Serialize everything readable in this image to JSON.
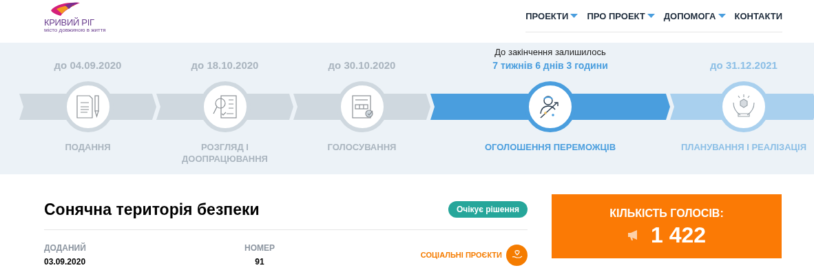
{
  "logo": {
    "name": "КРИВИЙ РІГ",
    "tagline": "місто довжиною в життя"
  },
  "nav": [
    {
      "label": "ПРОЕКТИ",
      "dropdown": true
    },
    {
      "label": "ПРО ПРОЕКТ",
      "dropdown": true
    },
    {
      "label": "ДОПОМОГА",
      "dropdown": true
    },
    {
      "label": "КОНТАКТИ",
      "dropdown": false
    }
  ],
  "stages": [
    {
      "kind": "past",
      "date": "до 04.09.2020",
      "label": "ПОДАННЯ"
    },
    {
      "kind": "past",
      "date": "до 18.10.2020",
      "label": "РОЗГЛЯД І ДООПРАЦЮВАННЯ"
    },
    {
      "kind": "past",
      "date": "до 30.10.2020",
      "label": "ГОЛОСУВАННЯ"
    },
    {
      "kind": "current",
      "countdown_label": "До закінчення залишилось",
      "countdown": "7 тижнів 6 днів 3 години",
      "label": "ОГОЛОШЕННЯ ПЕРЕМОЖЦІВ"
    },
    {
      "kind": "future",
      "date": "до 31.12.2021",
      "label": "ПЛАНУВАННЯ І РЕАЛІЗАЦІЯ"
    }
  ],
  "project": {
    "title": "Сонячна територія безпеки",
    "status_badge": "Очікує рішення",
    "fields": [
      {
        "label": "ДОДАНИЙ",
        "value": "03.09.2020"
      },
      {
        "label": "НОМЕР",
        "value": "91"
      }
    ],
    "category": "СОЦІАЛЬНІ ПРОЄКТИ"
  },
  "votes": {
    "label": "КІЛЬКІСТЬ ГОЛОСІВ:",
    "count": "1 422"
  }
}
